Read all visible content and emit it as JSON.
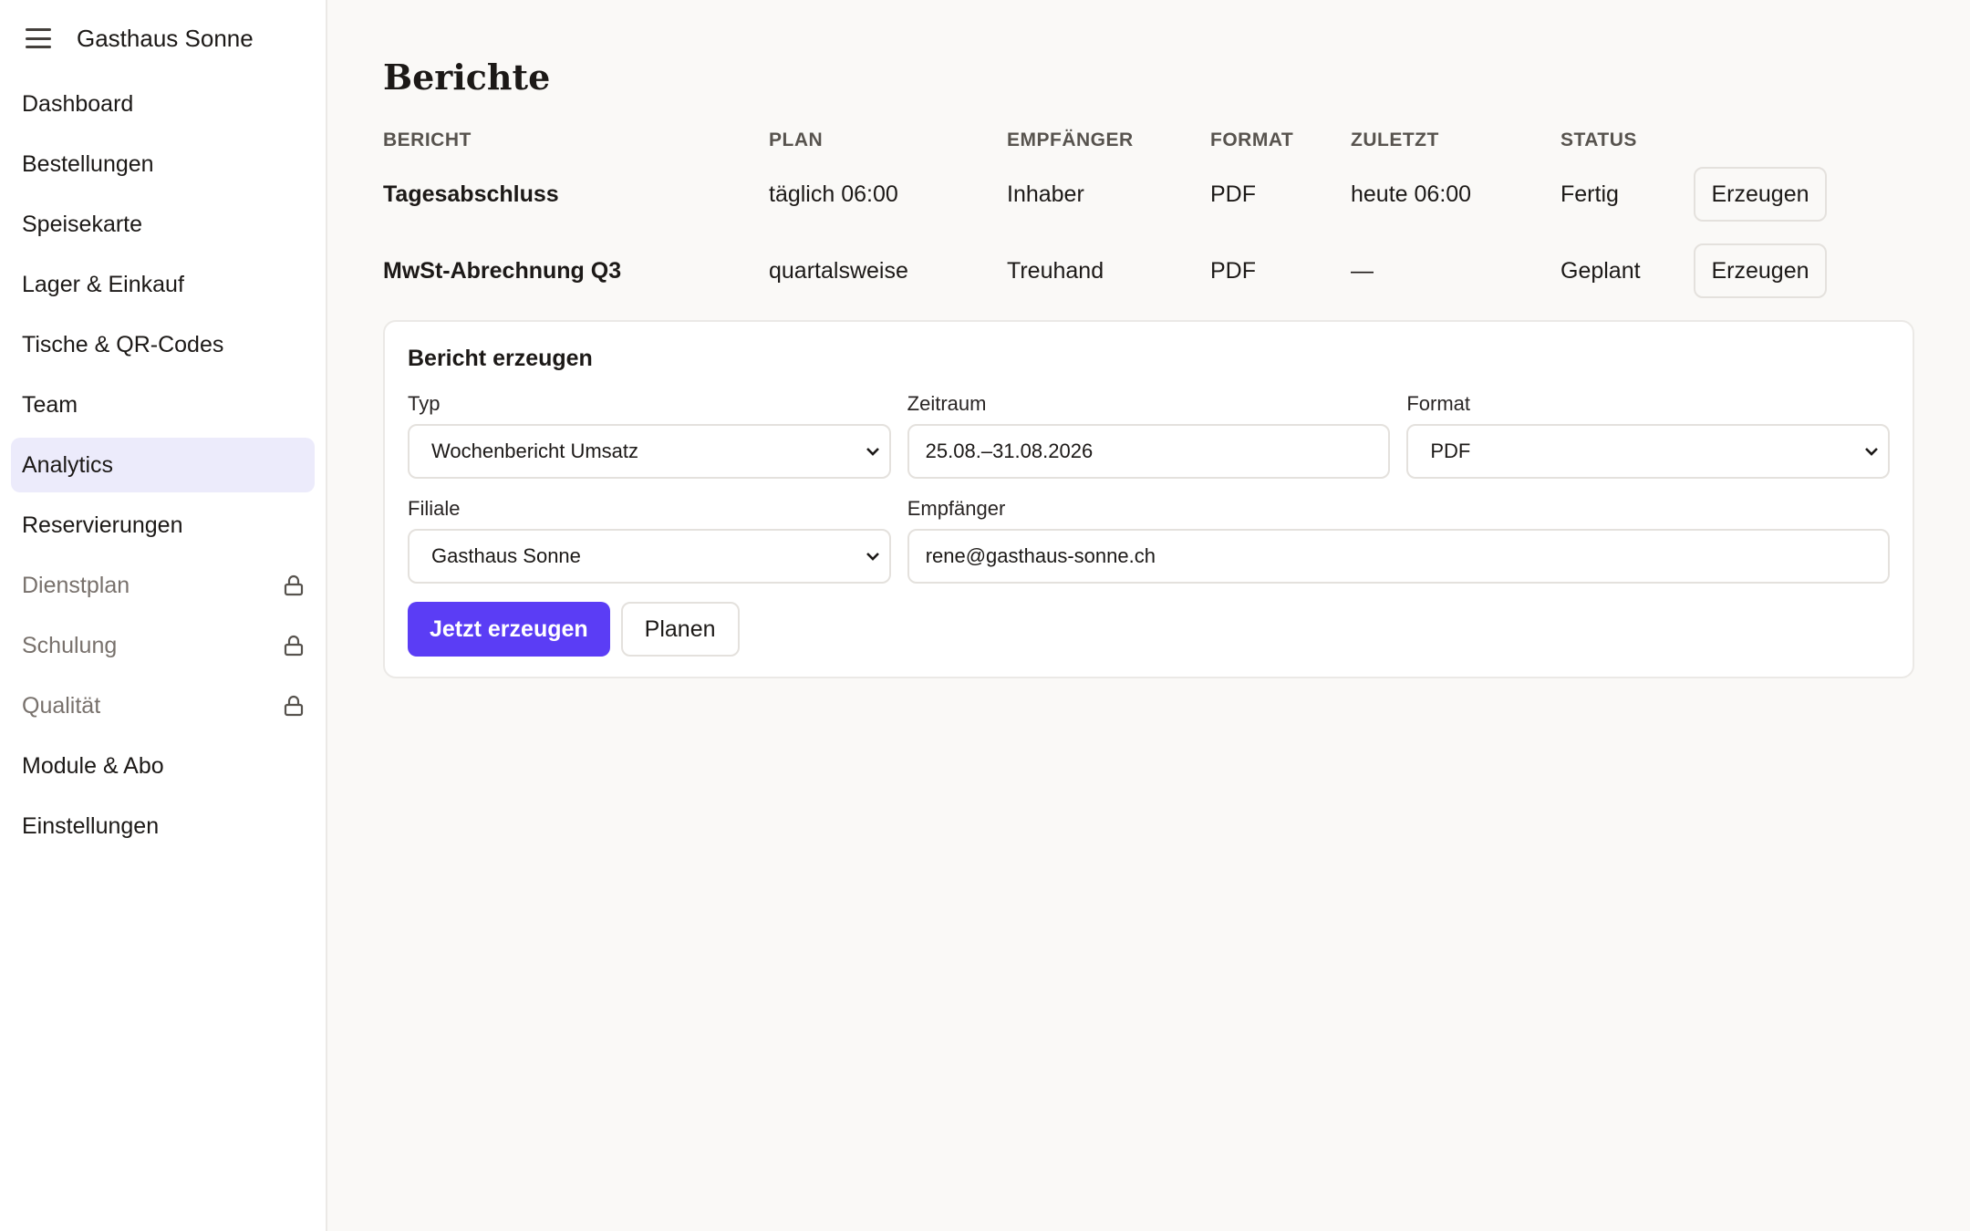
{
  "app": {
    "brand": "Gasthaus Sonne"
  },
  "sidebar": {
    "items": [
      {
        "label": "Dashboard",
        "locked": false,
        "active": false
      },
      {
        "label": "Bestellungen",
        "locked": false,
        "active": false
      },
      {
        "label": "Speisekarte",
        "locked": false,
        "active": false
      },
      {
        "label": "Lager & Einkauf",
        "locked": false,
        "active": false
      },
      {
        "label": "Tische & QR-Codes",
        "locked": false,
        "active": false
      },
      {
        "label": "Team",
        "locked": false,
        "active": false
      },
      {
        "label": "Analytics",
        "locked": false,
        "active": true
      },
      {
        "label": "Reservierungen",
        "locked": false,
        "active": false
      },
      {
        "label": "Dienstplan",
        "locked": true,
        "active": false,
        "icon": "lock-icon"
      },
      {
        "label": "Schulung",
        "locked": true,
        "active": false,
        "icon": "lock-icon"
      },
      {
        "label": "Qualität",
        "locked": true,
        "active": false,
        "icon": "lock-icon"
      },
      {
        "label": "Module & Abo",
        "locked": false,
        "active": false
      },
      {
        "label": "Einstellungen",
        "locked": false,
        "active": false
      }
    ]
  },
  "main": {
    "title": "Berichte",
    "table": {
      "headers": [
        "BERICHT",
        "PLAN",
        "EMPFÄNGER",
        "FORMAT",
        "ZULETZT",
        "STATUS"
      ],
      "rows": [
        {
          "name": "Tagesabschluss",
          "plan": "täglich 06:00",
          "recipient": "Inhaber",
          "format": "PDF",
          "last": "heute 06:00",
          "status": "Fertig",
          "action": "Erzeugen"
        },
        {
          "name": "MwSt-Abrechnung Q3",
          "plan": "quartalsweise",
          "recipient": "Treuhand",
          "format": "PDF",
          "last": "—",
          "status": "Geplant",
          "action": "Erzeugen"
        }
      ]
    },
    "form": {
      "title": "Bericht erzeugen",
      "type_label": "Typ",
      "type_value": "Wochenbericht Umsatz",
      "period_label": "Zeitraum",
      "period_value": "25.08.–31.08.2026",
      "format_label": "Format",
      "format_value": "PDF",
      "branch_label": "Filiale",
      "branch_value": "Gasthaus Sonne",
      "recipient_label": "Empfänger",
      "recipient_value": "rene@gasthaus-sonne.ch",
      "generate_now": "Jetzt erzeugen",
      "schedule": "Planen"
    }
  },
  "colors": {
    "accent": "#5b3df5",
    "active_nav_bg": "#ecebfb",
    "background": "#faf9f7"
  }
}
